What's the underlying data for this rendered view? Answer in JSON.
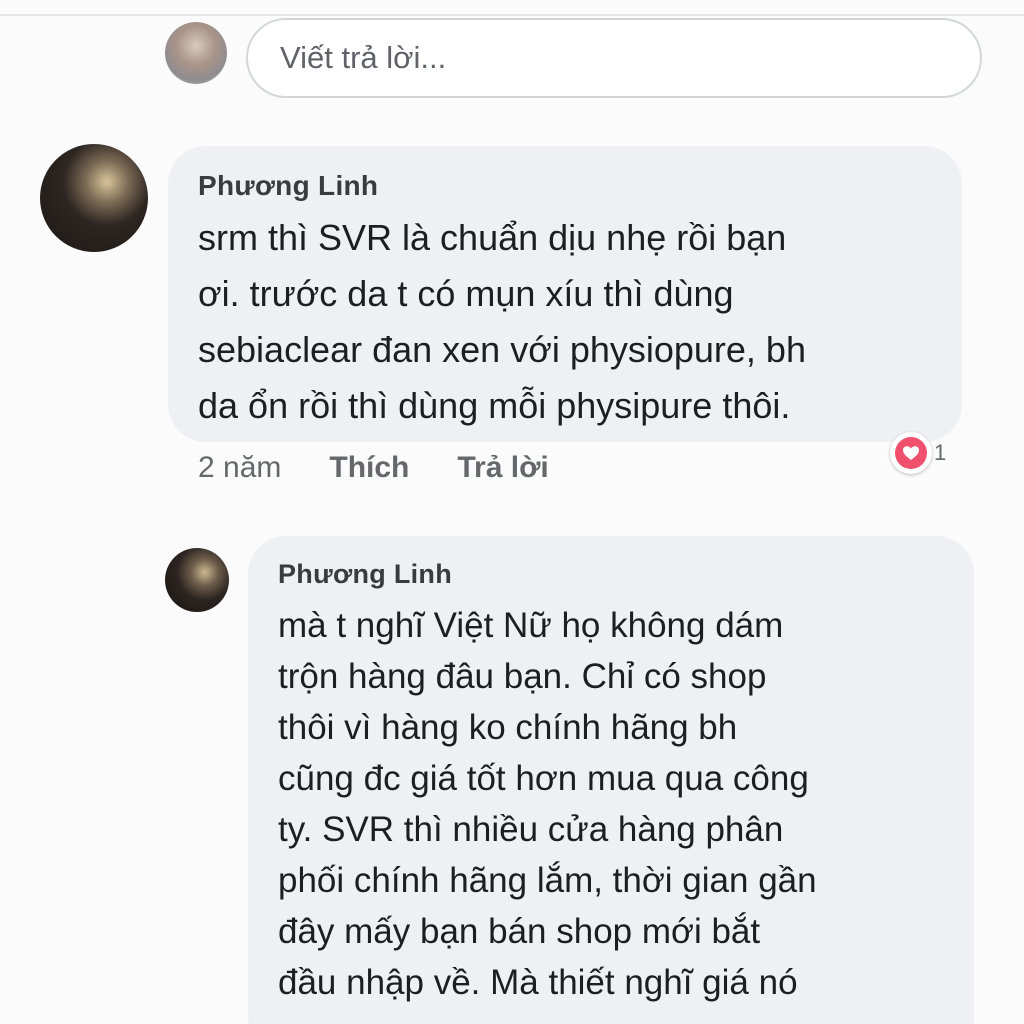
{
  "composer": {
    "placeholder": "Viết trả lời..."
  },
  "comments": [
    {
      "author": "Phương Linh",
      "text": "srm thì SVR là chuẩn dịu nhẹ rồi bạn\nơi. trước da t có mụn xíu thì dùng\nsebiaclear đan xen với physiopure, bh\nda ổn rồi thì dùng mỗi physipure thôi.",
      "time": "2 năm",
      "like_label": "Thích",
      "reply_label": "Trả lời",
      "reaction_icon": "heart-icon",
      "reaction_count": "1"
    },
    {
      "author": "Phương Linh",
      "text": "mà t nghĩ Việt Nữ họ không dám\ntrộn hàng đâu bạn. Chỉ có shop\nthôi vì hàng ko chính hãng bh\ncũng đc giá tốt hơn mua qua công\nty. SVR thì nhiều cửa hàng phân\nphối chính hãng lắm, thời gian gần\nđây mấy bạn bán shop mới bắt\nđầu nhập về. Mà thiết nghĩ giá nó"
    }
  ],
  "colors": {
    "bubble": "#eff0f4",
    "reaction": "#f33e58"
  }
}
